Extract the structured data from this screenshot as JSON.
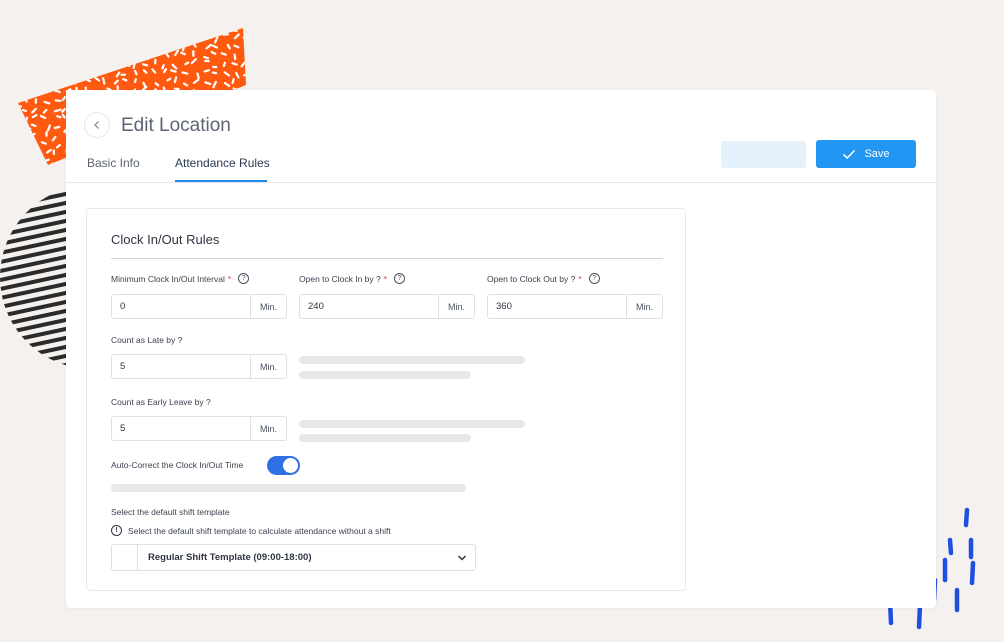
{
  "header": {
    "title": "Edit Location",
    "tabs": [
      {
        "label": "Basic Info",
        "active": false
      },
      {
        "label": "Attendance Rules",
        "active": true
      }
    ],
    "save_label": "Save"
  },
  "section": {
    "title": "Clock In/Out Rules",
    "fields": [
      {
        "label": "Minimum Clock In/Out Interval",
        "required": "*",
        "help": "?",
        "value": "0",
        "unit": "Min."
      },
      {
        "label": "Open to Clock In by ?",
        "required": "*",
        "help": "?",
        "value": "240",
        "unit": "Min."
      },
      {
        "label": "Open to Clock Out by ?",
        "required": "*",
        "help": "?",
        "value": "360",
        "unit": "Min."
      },
      {
        "label": "Count as Late by ?",
        "value": "5",
        "unit": "Min."
      },
      {
        "label": "Count as Early Leave by ?",
        "value": "5",
        "unit": "Min."
      }
    ],
    "auto_correct": {
      "label": "Auto-Correct the Clock In/Out Time",
      "enabled": true
    },
    "shift": {
      "label": "Select the default shift template",
      "info_icon": "!",
      "info": "Select the default shift template to calculate attendance without a shift",
      "selected": "Regular Shift Template (09:00-18:00)"
    }
  },
  "colors": {
    "accent": "#2196f3",
    "toggle": "#2f6fe4",
    "required": "#e53935",
    "deco_orange": "#ff5a10",
    "deco_blue": "#1f4fe0"
  }
}
